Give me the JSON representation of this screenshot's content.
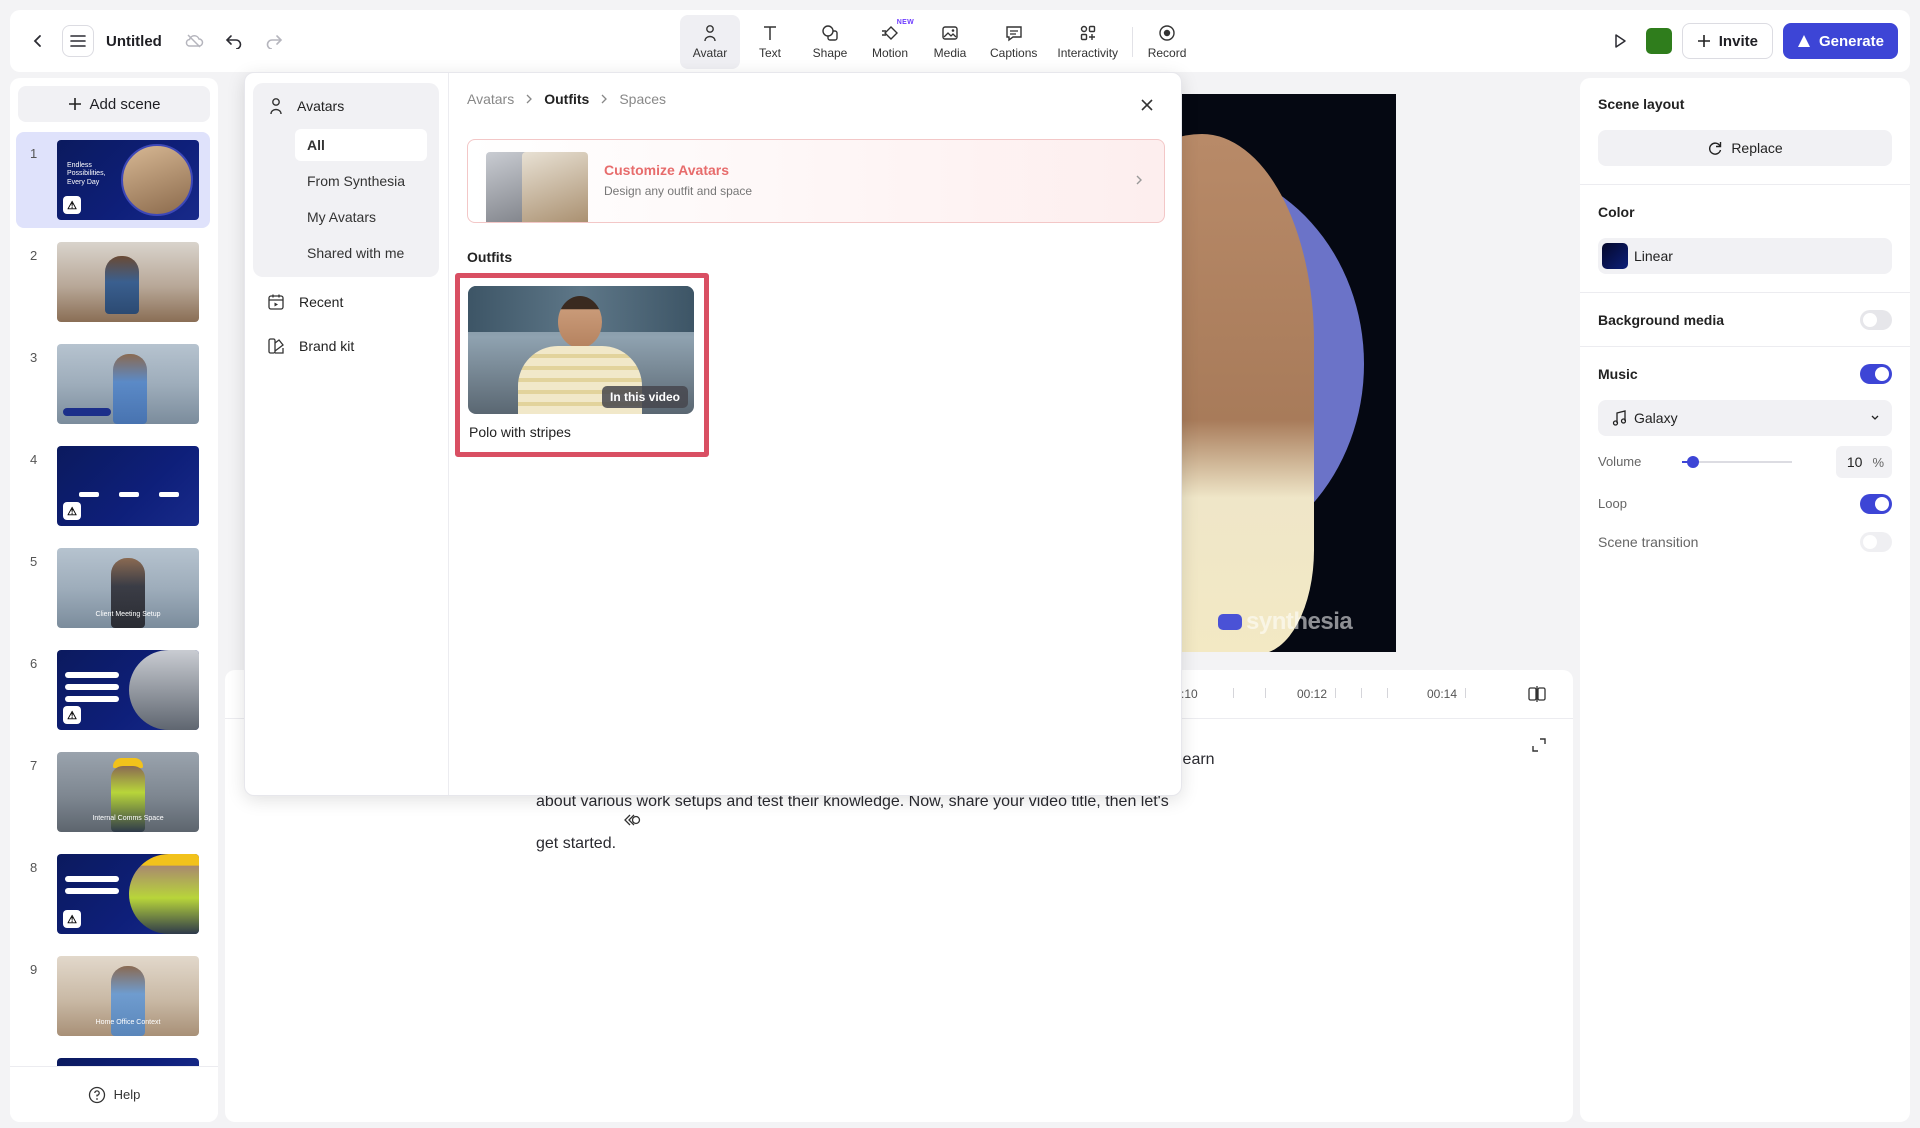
{
  "topbar": {
    "title": "Untitled",
    "tools": [
      {
        "label": "Avatar",
        "icon": "avatar-icon",
        "active": true
      },
      {
        "label": "Text",
        "icon": "text-icon"
      },
      {
        "label": "Shape",
        "icon": "shape-icon"
      },
      {
        "label": "Motion",
        "icon": "motion-icon",
        "badge": "NEW"
      },
      {
        "label": "Media",
        "icon": "media-icon"
      },
      {
        "label": "Captions",
        "icon": "captions-icon"
      },
      {
        "label": "Interactivity",
        "icon": "interactivity-icon"
      },
      {
        "label": "Record",
        "icon": "record-icon"
      }
    ],
    "invite_label": "Invite",
    "generate_label": "Generate",
    "color_swatch": "#2f7d1c",
    "accent": "#3d45d6"
  },
  "scenes": {
    "add_label": "Add scene",
    "items": [
      {
        "num": "1",
        "selected": true,
        "warning": true,
        "thumb_text": "Endless Possibilities, Every Day"
      },
      {
        "num": "2"
      },
      {
        "num": "3"
      },
      {
        "num": "4",
        "warning": true
      },
      {
        "num": "5",
        "thumb_text": "Client Meeting Setup"
      },
      {
        "num": "6",
        "warning": true
      },
      {
        "num": "7",
        "thumb_text": "Internal Comms Space"
      },
      {
        "num": "8",
        "warning": true
      },
      {
        "num": "9",
        "thumb_text": "Home Office Context"
      }
    ],
    "help_label": "Help"
  },
  "avatar_panel": {
    "nav": {
      "header": "Avatars",
      "sub_items": [
        "All",
        "From Synthesia",
        "My Avatars",
        "Shared with me"
      ],
      "active_sub": "All",
      "items": [
        {
          "label": "Recent",
          "icon": "recent-icon"
        },
        {
          "label": "Brand kit",
          "icon": "brand-kit-icon"
        }
      ]
    },
    "breadcrumb": [
      "Avatars",
      "Outfits",
      "Spaces"
    ],
    "current_crumb": "Outfits",
    "banner": {
      "title": "Customize Avatars",
      "subtitle": "Design any outfit and space"
    },
    "section_title": "Outfits",
    "outfits": [
      {
        "label": "Polo with stripes",
        "badge": "In this video"
      }
    ]
  },
  "canvas": {
    "watermark": "synthesia"
  },
  "timeline": {
    "ticks": [
      ":10",
      "00:12",
      "00:14"
    ]
  },
  "script": {
    "lines": [
      "learn",
      "about various work setups and test their knowledge. Now, share your video title, then let's",
      "get started."
    ]
  },
  "properties": {
    "scene_layout_label": "Scene layout",
    "replace_label": "Replace",
    "color_label": "Color",
    "color_value": "Linear",
    "background_media_label": "Background media",
    "background_media_on": false,
    "music_label": "Music",
    "music_on": true,
    "music_track": "Galaxy",
    "volume_label": "Volume",
    "volume_value": "10",
    "volume_unit": "%",
    "volume_fraction": 0.1,
    "loop_label": "Loop",
    "loop_on": true,
    "scene_transition_label": "Scene transition",
    "scene_transition_on": false
  }
}
